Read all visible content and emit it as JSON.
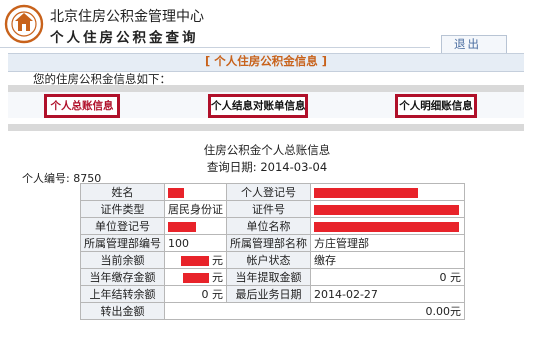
{
  "header": {
    "title_main": "北京住房公积金管理中心",
    "title_sub": "个人住房公积金查询",
    "logout_label": "退出"
  },
  "section": {
    "title": "[ 个人住房公积金信息 ]",
    "intro": "您的住房公积金信息如下："
  },
  "tabs": [
    {
      "label": "个人总账信息",
      "active": true
    },
    {
      "label": "个人结息对账单信息",
      "active": false
    },
    {
      "label": "个人明细账信息",
      "active": false
    }
  ],
  "summary": {
    "title": "住房公积金个人总账信息",
    "query_date": "查询日期: 2014-03-04",
    "person_no": "个人编号: 8750"
  },
  "table": {
    "name_label": "姓名",
    "reg_no_label": "个人登记号",
    "id_type_label": "证件类型",
    "id_type_value": "居民身份证",
    "id_no_label": "证件号",
    "unit_reg_label": "单位登记号",
    "unit_name_label": "单位名称",
    "dept_no_label": "所属管理部编号",
    "dept_no_value": "100",
    "dept_name_label": "所属管理部名称",
    "dept_name_value": "方庄管理部",
    "balance_label": "当前余额",
    "balance_unit": "元",
    "status_label": "帐户状态",
    "status_value": "缴存",
    "year_deposit_label": "当年缴存金额",
    "year_deposit_unit": "元",
    "year_withdraw_label": "当年提取金额",
    "year_withdraw_value": "0 元",
    "last_interest_label": "上年结转余额",
    "last_interest_value": "0 元",
    "last_date_label": "最后业务日期",
    "last_date_value": "2014-02-27",
    "transfer_label": "转出金额",
    "transfer_value": "0.00元"
  },
  "colors": {
    "accent": "#c8621b",
    "highlight_border": "#b0102a",
    "redaction": "#e8232a"
  }
}
